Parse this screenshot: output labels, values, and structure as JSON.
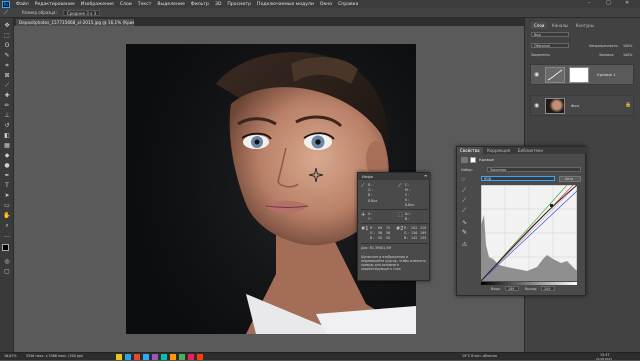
{
  "app": {
    "logo": "Ps",
    "menu": [
      "Файл",
      "Редактирование",
      "Изображение",
      "Слои",
      "Текст",
      "Выделение",
      "Фильтр",
      "3D",
      "Просмотр",
      "Подключаемые модули",
      "Окно",
      "Справка"
    ]
  },
  "options_bar": {
    "size_label": "Размер образца:",
    "size_value": "Среднее 3 x 3"
  },
  "document": {
    "tab_title": "Depositphotos_157715668_xl-2015.jpg @ 16,1% (Кривые 1, RGB/8) *"
  },
  "right_panel": {
    "top_tabs": [
      "Слои",
      "Каналы",
      "Контуры"
    ],
    "search_placeholder": "Вид",
    "blend_mode": "Обычные",
    "opacity_label": "Непрозрачность:",
    "opacity_value": "100%",
    "lock_label": "Закрепить:",
    "fill_label": "Заливка:",
    "fill_value": "100%",
    "layers": [
      {
        "name": "Кривые 1",
        "selected": true
      },
      {
        "name": "Фон",
        "selected": false
      }
    ]
  },
  "properties": {
    "tabs": [
      "Свойства",
      "Коррекция",
      "Библиотеки"
    ],
    "panel_title": "Кривые",
    "preset_label": "Набор:",
    "preset_value": "Заказная",
    "channel_value": "RGB",
    "auto_button": "Авто",
    "input_label": "Вход:",
    "input_value": "189",
    "output_label": "Выход:",
    "output_value": "209",
    "accent_color": "#31a8ff"
  },
  "info_panel": {
    "title": "Инфо",
    "r_label": "R :",
    "g_label": "G :",
    "b_label": "B :",
    "r1": "",
    "g1": "",
    "b1": "",
    "bit1": "8-бит",
    "bit2": "8-бит",
    "c_label": "C :",
    "m_label": "M :",
    "y_label": "Y :",
    "k_label": "K :",
    "x_label": "X :",
    "y2_label": "Y :",
    "w_label": "Ш :",
    "h_label": "В :",
    "sample_r": "69",
    "sample_r2": "70",
    "sample_g": "56",
    "sample_g2": "56",
    "sample_b": "50",
    "sample_b2": "50",
    "sample2_r": "202",
    "sample2_r2": "220",
    "sample2_g": "156",
    "sample2_g2": "169",
    "sample2_b": "142",
    "sample2_b2": "155",
    "doc_label": "Док: 81,3M/81,3M",
    "hint": "Щелкните в изображении и перемещайте курсор, чтобы изменить кривую для активного корректирующего слоя"
  },
  "status": {
    "zoom": "16,67%",
    "size": "5556 пикс. x 5568 пикс. (300 ppi)"
  },
  "taskbar": {
    "weather": "19°C  В осн. облачно",
    "time": "15:47",
    "date": "24.08.2021"
  }
}
